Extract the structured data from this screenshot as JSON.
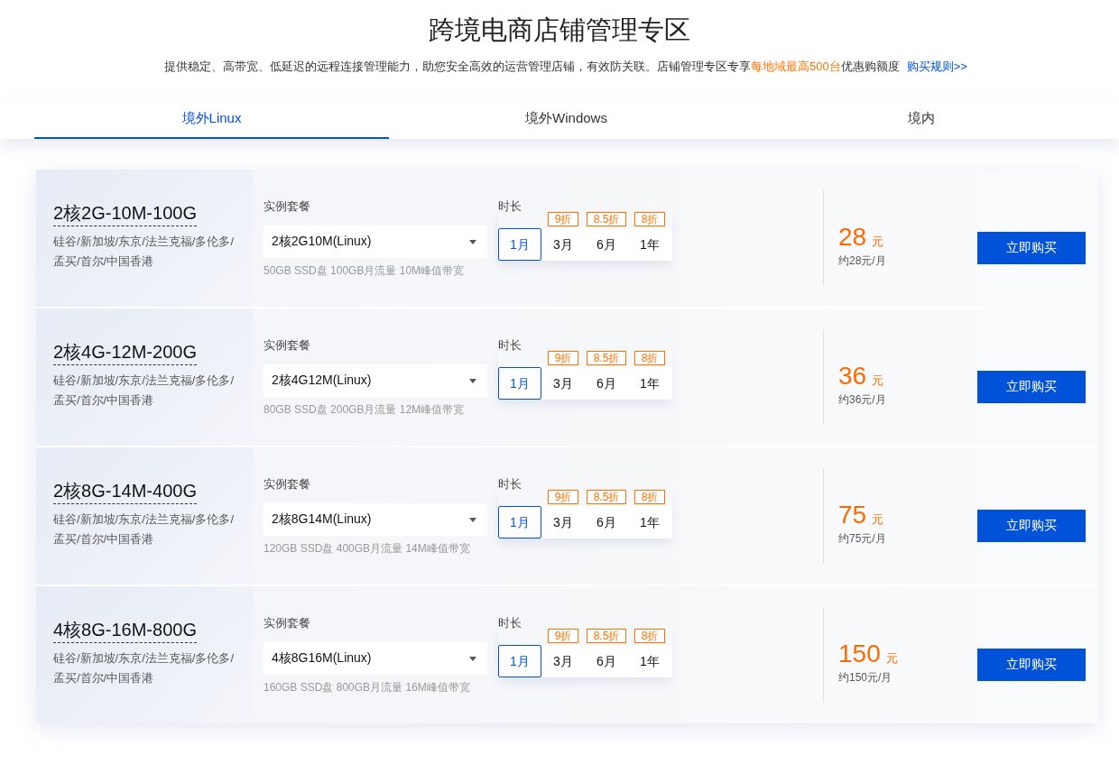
{
  "title": "跨境电商店铺管理专区",
  "subtitle": {
    "before": "提供稳定、高带宽、低延迟的远程连接管理能力，助您安全高效的运营管理店铺，有效防关联。店铺管理专区专享",
    "highlight": "每地域最高500台",
    "after": "优惠购额度",
    "link": "购买规则>>"
  },
  "tabs": [
    {
      "label": "境外Linux",
      "selected": true
    },
    {
      "label": "境外Windows",
      "selected": false
    },
    {
      "label": "境内",
      "selected": false
    }
  ],
  "products": [
    {
      "name": "2核2G-10M-100G",
      "regions": "硅谷/新加坡/东京/法兰克福/多伦多/孟买/首尔/中国香港",
      "package_label": "实例套餐",
      "package": "2核2G10M(Linux)",
      "spec": "50GB SSD盘 100GB月流量 10M峰值带宽",
      "duration_label": "时长",
      "durations": [
        {
          "label": "1月",
          "selected": true
        },
        {
          "label": "3月",
          "selected": false,
          "discount": "9折"
        },
        {
          "label": "6月",
          "selected": false,
          "discount": "8.5折"
        },
        {
          "label": "1年",
          "selected": false,
          "discount": "8折"
        }
      ],
      "price": "28",
      "unit": "元",
      "monthly": "约28元/月",
      "button": "立即购买"
    },
    {
      "name": "2核4G-12M-200G",
      "regions": "硅谷/新加坡/东京/法兰克福/多伦多/孟买/首尔/中国香港",
      "package_label": "实例套餐",
      "package": "2核4G12M(Linux)",
      "spec": "80GB SSD盘 200GB月流量 12M峰值带宽",
      "duration_label": "时长",
      "durations": [
        {
          "label": "1月",
          "selected": true
        },
        {
          "label": "3月",
          "selected": false,
          "discount": "9折"
        },
        {
          "label": "6月",
          "selected": false,
          "discount": "8.5折"
        },
        {
          "label": "1年",
          "selected": false,
          "discount": "8折"
        }
      ],
      "price": "36",
      "unit": "元",
      "monthly": "约36元/月",
      "button": "立即购买"
    },
    {
      "name": "2核8G-14M-400G",
      "regions": "硅谷/新加坡/东京/法兰克福/多伦多/孟买/首尔/中国香港",
      "package_label": "实例套餐",
      "package": "2核8G14M(Linux)",
      "spec": "120GB SSD盘 400GB月流量 14M峰值带宽",
      "duration_label": "时长",
      "durations": [
        {
          "label": "1月",
          "selected": true
        },
        {
          "label": "3月",
          "selected": false,
          "discount": "9折"
        },
        {
          "label": "6月",
          "selected": false,
          "discount": "8.5折"
        },
        {
          "label": "1年",
          "selected": false,
          "discount": "8折"
        }
      ],
      "price": "75",
      "unit": "元",
      "monthly": "约75元/月",
      "button": "立即购买"
    },
    {
      "name": "4核8G-16M-800G",
      "regions": "硅谷/新加坡/东京/法兰克福/多伦多/孟买/首尔/中国香港",
      "package_label": "实例套餐",
      "package": "4核8G16M(Linux)",
      "spec": "160GB SSD盘 800GB月流量 16M峰值带宽",
      "duration_label": "时长",
      "durations": [
        {
          "label": "1月",
          "selected": true
        },
        {
          "label": "3月",
          "selected": false,
          "discount": "9折"
        },
        {
          "label": "6月",
          "selected": false,
          "discount": "8.5折"
        },
        {
          "label": "1年",
          "selected": false,
          "discount": "8折"
        }
      ],
      "price": "150",
      "unit": "元",
      "monthly": "约150元/月",
      "button": "立即购买"
    }
  ]
}
